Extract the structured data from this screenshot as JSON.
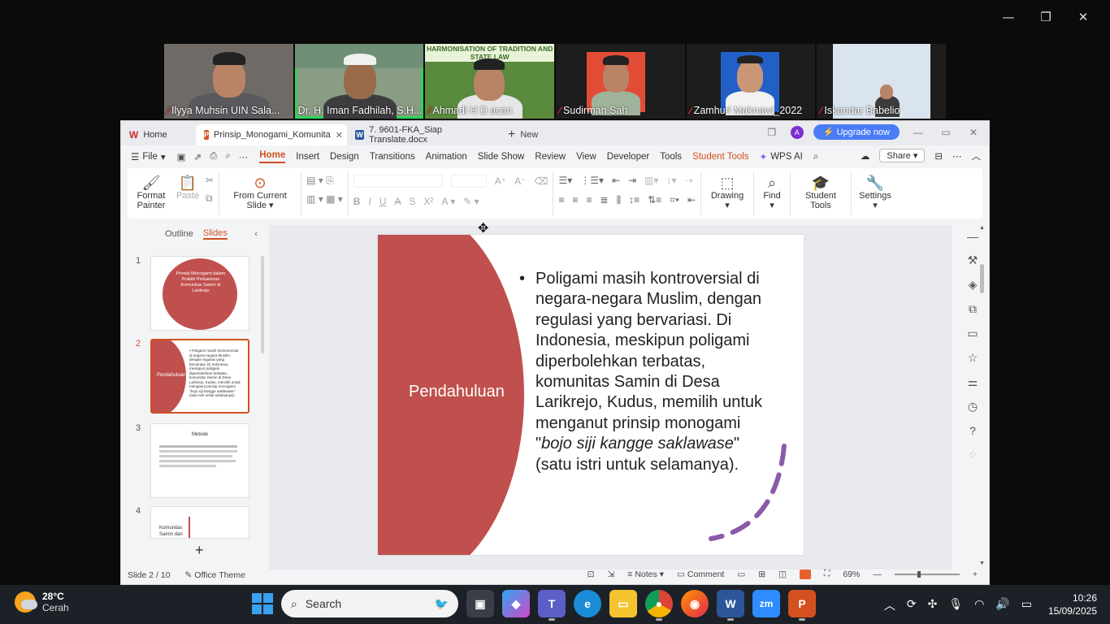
{
  "zoom_window": {
    "controls": [
      "—",
      "❐",
      "✕"
    ]
  },
  "participants": [
    {
      "name": "Ilyya Muhsin UIN Sala...",
      "muted": true,
      "active": false
    },
    {
      "name": "Dr. H. Iman Fadhilah, S.H...",
      "muted": false,
      "active": true
    },
    {
      "name": "Ahmadi H D acan",
      "muted": true,
      "active": false,
      "banner": "HARMONISATION OF TRADITION AND STATE LAW"
    },
    {
      "name": "Sudirman Sah",
      "muted": true,
      "active": false
    },
    {
      "name": "Zamhuri Maknawi_2022",
      "muted": true,
      "active": false
    },
    {
      "name": "Iskandar Babelio",
      "muted": true,
      "active": false
    }
  ],
  "wps": {
    "tabs": {
      "home": "Home",
      "active": "Prinsip_Monogami_Komunita",
      "doc": "7. 9601-FKA_Siap Translate.docx",
      "new": "New"
    },
    "avatar_letter": "A",
    "upgrade_label": "Upgrade now",
    "menu": {
      "file": "File",
      "items": [
        "Home",
        "Insert",
        "Design",
        "Transitions",
        "Animation",
        "Slide Show",
        "Review",
        "View",
        "Developer",
        "Tools",
        "Student Tools"
      ],
      "wps_ai": "WPS AI",
      "share": "Share"
    },
    "ribbon": {
      "format_painter": "Format Painter",
      "paste": "Paste",
      "from_current_slide": "From Current Slide",
      "drawing": "Drawing",
      "find": "Find",
      "student_tools": "Student Tools",
      "settings": "Settings"
    },
    "left_panel": {
      "outline_tab": "Outline",
      "slides_tab": "Slides",
      "thumbnails": [
        {
          "num": "1",
          "title": "Prinsip Monogami dalam Praktik Perkawinan Komunitas Samin di Larikrejo"
        },
        {
          "num": "2",
          "title": "Pendahuluan"
        },
        {
          "num": "3",
          "title": "Metode"
        },
        {
          "num": "4",
          "title": "Komunitas Samin dan"
        }
      ]
    },
    "slide": {
      "title": "Pendahuluan",
      "body_pre": "Poligami masih kontroversial di negara-negara Muslim, dengan regulasi yang bervariasi. Di Indonesia, meskipun poligami diperbolehkan terbatas, komunitas Samin di Desa Larikrejo, Kudus, memilih untuk menganut prinsip monogami \"",
      "body_italic": "bojo siji kangge saklawase",
      "body_post": "\" (satu istri untuk selamanya).",
      "accent_color": "#c0504d"
    },
    "status": {
      "slide_counter": "Slide 2 / 10",
      "theme": "Office Theme",
      "notes": "Notes",
      "comment": "Comment",
      "zoom": "69%"
    }
  },
  "taskbar": {
    "weather_temp": "28°C",
    "weather_desc": "Cerah",
    "search_placeholder": "Search",
    "time": "10:26",
    "date": "15/09/2025"
  }
}
